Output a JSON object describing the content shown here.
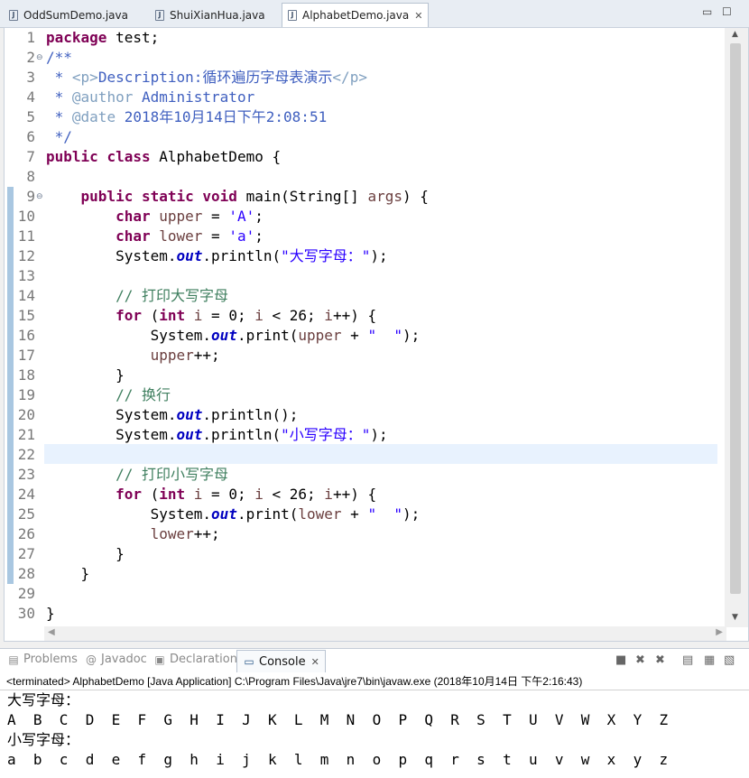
{
  "editor_tabs": [
    {
      "label": "OddSumDemo.java",
      "active": false
    },
    {
      "label": "ShuiXianHua.java",
      "active": false
    },
    {
      "label": "AlphabetDemo.java",
      "active": true
    }
  ],
  "editor": {
    "line_numbers": [
      "1",
      "2",
      "3",
      "4",
      "5",
      "6",
      "7",
      "8",
      "9",
      "10",
      "11",
      "12",
      "13",
      "14",
      "15",
      "16",
      "17",
      "18",
      "19",
      "20",
      "21",
      "22",
      "23",
      "24",
      "25",
      "26",
      "27",
      "28",
      "29",
      "30"
    ],
    "code": [
      [
        {
          "t": "package",
          "c": "kw"
        },
        {
          "t": " test;"
        }
      ],
      [
        {
          "t": "/**",
          "c": "jd"
        }
      ],
      [
        {
          "t": " * ",
          "c": "jd"
        },
        {
          "t": "<p>",
          "c": "jt"
        },
        {
          "t": "Description:循环遍历字母表演示",
          "c": "jd"
        },
        {
          "t": "</p>",
          "c": "jt"
        }
      ],
      [
        {
          "t": " * ",
          "c": "jd"
        },
        {
          "t": "@author",
          "c": "jt"
        },
        {
          "t": " Administrator",
          "c": "jd"
        }
      ],
      [
        {
          "t": " * ",
          "c": "jd"
        },
        {
          "t": "@date",
          "c": "jt"
        },
        {
          "t": " 2018年10月14日下午2:08:51",
          "c": "jd"
        }
      ],
      [
        {
          "t": " */",
          "c": "jd"
        }
      ],
      [
        {
          "t": "public",
          "c": "kw"
        },
        {
          "t": " "
        },
        {
          "t": "class",
          "c": "kw"
        },
        {
          "t": " AlphabetDemo {"
        }
      ],
      [],
      [
        {
          "t": "    "
        },
        {
          "t": "public",
          "c": "kw"
        },
        {
          "t": " "
        },
        {
          "t": "static",
          "c": "kw"
        },
        {
          "t": " "
        },
        {
          "t": "void",
          "c": "kw"
        },
        {
          "t": " main(String[] "
        },
        {
          "t": "args",
          "c": "vr"
        },
        {
          "t": ") {"
        }
      ],
      [
        {
          "t": "        "
        },
        {
          "t": "char",
          "c": "kw"
        },
        {
          "t": " "
        },
        {
          "t": "upper",
          "c": "vr"
        },
        {
          "t": " = "
        },
        {
          "t": "'A'",
          "c": "st"
        },
        {
          "t": ";"
        }
      ],
      [
        {
          "t": "        "
        },
        {
          "t": "char",
          "c": "kw"
        },
        {
          "t": " "
        },
        {
          "t": "lower",
          "c": "vr"
        },
        {
          "t": " = "
        },
        {
          "t": "'a'",
          "c": "st"
        },
        {
          "t": ";"
        }
      ],
      [
        {
          "t": "        System."
        },
        {
          "t": "out",
          "c": "fi"
        },
        {
          "t": ".println("
        },
        {
          "t": "\"大写字母：\"",
          "c": "st"
        },
        {
          "t": ");"
        }
      ],
      [],
      [
        {
          "t": "        "
        },
        {
          "t": "// 打印大写字母",
          "c": "cm"
        }
      ],
      [
        {
          "t": "        "
        },
        {
          "t": "for",
          "c": "kw"
        },
        {
          "t": " ("
        },
        {
          "t": "int",
          "c": "kw"
        },
        {
          "t": " "
        },
        {
          "t": "i",
          "c": "vr"
        },
        {
          "t": " = 0; "
        },
        {
          "t": "i",
          "c": "vr"
        },
        {
          "t": " < 26; "
        },
        {
          "t": "i",
          "c": "vr"
        },
        {
          "t": "++) {"
        }
      ],
      [
        {
          "t": "            System."
        },
        {
          "t": "out",
          "c": "fi"
        },
        {
          "t": ".print("
        },
        {
          "t": "upper",
          "c": "vr"
        },
        {
          "t": " + "
        },
        {
          "t": "\"  \"",
          "c": "st"
        },
        {
          "t": ");"
        }
      ],
      [
        {
          "t": "            "
        },
        {
          "t": "upper",
          "c": "vr"
        },
        {
          "t": "++;"
        }
      ],
      [
        {
          "t": "        }"
        }
      ],
      [
        {
          "t": "        "
        },
        {
          "t": "// 换行",
          "c": "cm"
        }
      ],
      [
        {
          "t": "        System."
        },
        {
          "t": "out",
          "c": "fi"
        },
        {
          "t": ".println();"
        }
      ],
      [
        {
          "t": "        System."
        },
        {
          "t": "out",
          "c": "fi"
        },
        {
          "t": ".println("
        },
        {
          "t": "\"小写字母：\"",
          "c": "st"
        },
        {
          "t": ");"
        }
      ],
      [],
      [
        {
          "t": "        "
        },
        {
          "t": "// 打印小写字母",
          "c": "cm"
        }
      ],
      [
        {
          "t": "        "
        },
        {
          "t": "for",
          "c": "kw"
        },
        {
          "t": " ("
        },
        {
          "t": "int",
          "c": "kw"
        },
        {
          "t": " "
        },
        {
          "t": "i",
          "c": "vr"
        },
        {
          "t": " = 0; "
        },
        {
          "t": "i",
          "c": "vr"
        },
        {
          "t": " < 26; "
        },
        {
          "t": "i",
          "c": "vr"
        },
        {
          "t": "++) {"
        }
      ],
      [
        {
          "t": "            System."
        },
        {
          "t": "out",
          "c": "fi"
        },
        {
          "t": ".print("
        },
        {
          "t": "lower",
          "c": "vr"
        },
        {
          "t": " + "
        },
        {
          "t": "\"  \"",
          "c": "st"
        },
        {
          "t": ");"
        }
      ],
      [
        {
          "t": "            "
        },
        {
          "t": "lower",
          "c": "vr"
        },
        {
          "t": "++;"
        }
      ],
      [
        {
          "t": "        }"
        }
      ],
      [
        {
          "t": "    }"
        }
      ],
      [],
      [
        {
          "t": "}"
        }
      ]
    ],
    "fold_markers": [
      "2",
      "9"
    ],
    "current_line": "22"
  },
  "view_tabs": [
    {
      "label": "Problems",
      "icon": "problems-icon",
      "active": false
    },
    {
      "label": "Javadoc",
      "icon": "at-icon",
      "active": false
    },
    {
      "label": "Declaration",
      "icon": "declaration-icon",
      "active": false
    },
    {
      "label": "Console",
      "icon": "console-icon",
      "active": true
    }
  ],
  "console": {
    "status": "<terminated> AlphabetDemo [Java Application] C:\\Program Files\\Java\\jre7\\bin\\javaw.exe (2018年10月14日 下午2:16:43)",
    "output": [
      "大写字母：",
      "A  B  C  D  E  F  G  H  I  J  K  L  M  N  O  P  Q  R  S  T  U  V  W  X  Y  Z",
      "小写字母：",
      "a  b  c  d  e  f  g  h  i  j  k  l  m  n  o  p  q  r  s  t  u  v  w  x  y  z"
    ]
  },
  "icons": {
    "close": "✕",
    "minimize": "▭",
    "maximize": "☐",
    "fold": "⊖"
  }
}
